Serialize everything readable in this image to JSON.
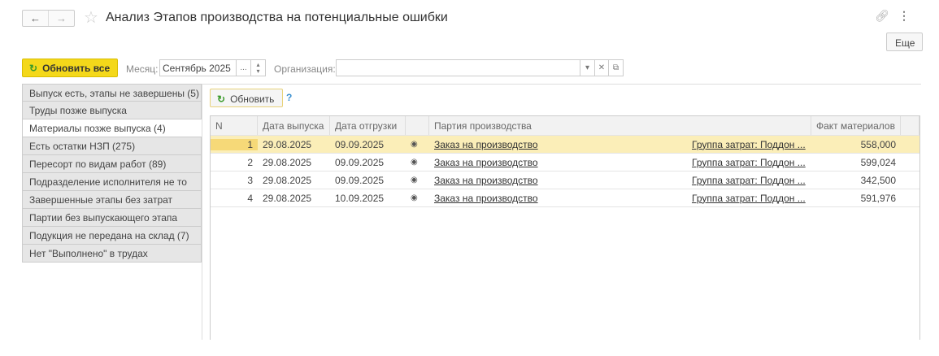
{
  "header": {
    "title": "Анализ Этапов производства на потенциальные ошибки",
    "back": "←",
    "forward": "→",
    "more_label": "Еще"
  },
  "toolbar": {
    "refresh_all": "Обновить все",
    "month_label": "Месяц:",
    "month_value": "Сентябрь 2025",
    "org_label": "Организация:",
    "org_value": ""
  },
  "sidebar": {
    "items": [
      "Выпуск есть, этапы не завершены (5)",
      "Труды позже выпуска",
      "Материалы позже выпуска (4)",
      "Есть остатки НЗП (275)",
      "Пересорт по видам работ (89)",
      "Подразделение исполнителя не то",
      "Завершенные этапы без затрат",
      "Партии без выпускающего этапа",
      "Подукция не передана на склад (7)",
      "Нет \"Выполнено\" в трудах"
    ],
    "selected": 2
  },
  "panel": {
    "refresh": "Обновить",
    "help": "?"
  },
  "table": {
    "columns": [
      "N",
      "Дата выпуска",
      "Дата отгрузки",
      "",
      "Партия производства",
      "Факт материалов"
    ],
    "rows": [
      {
        "n": "1",
        "release": "29.08.2025",
        "ship": "09.09.2025",
        "batch": "Заказ на производство",
        "group": "Группа затрат: Поддон ...",
        "fact": "558,000"
      },
      {
        "n": "2",
        "release": "29.08.2025",
        "ship": "09.09.2025",
        "batch": "Заказ на производство",
        "group": "Группа затрат: Поддон ...",
        "fact": "599,024"
      },
      {
        "n": "3",
        "release": "29.08.2025",
        "ship": "09.09.2025",
        "batch": "Заказ на производство",
        "group": "Группа затрат: Поддон ...",
        "fact": "342,500"
      },
      {
        "n": "4",
        "release": "29.08.2025",
        "ship": "10.09.2025",
        "batch": "Заказ на производство",
        "group": "Группа затрат: Поддон ...",
        "fact": "591,976"
      }
    ]
  }
}
